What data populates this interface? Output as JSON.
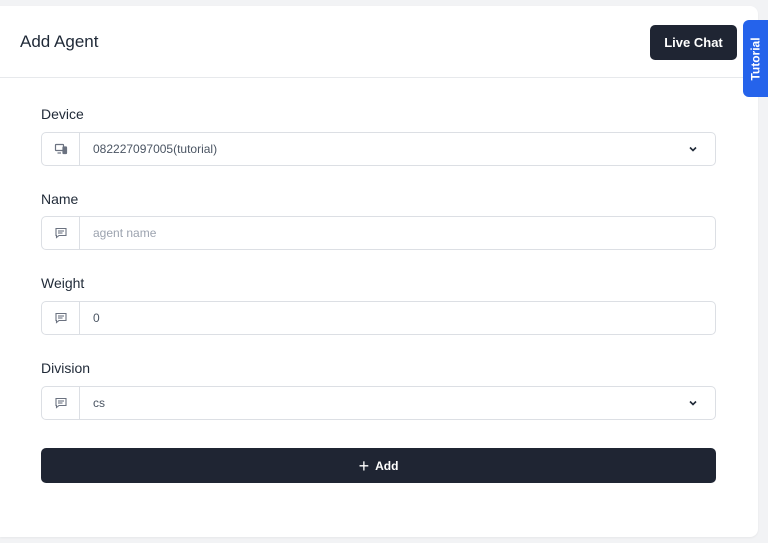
{
  "header": {
    "title": "Add Agent",
    "live_chat_label": "Live Chat"
  },
  "tutorial_tab": {
    "label": "Tutorial"
  },
  "form": {
    "device": {
      "label": "Device",
      "value": "082227097005(tutorial)",
      "icon": "device-icon"
    },
    "name": {
      "label": "Name",
      "value": "",
      "placeholder": "agent name",
      "icon": "message-icon"
    },
    "weight": {
      "label": "Weight",
      "value": "0",
      "icon": "message-icon"
    },
    "division": {
      "label": "Division",
      "value": "cs",
      "icon": "message-icon"
    },
    "submit": {
      "icon": "plus-icon",
      "label": "Add"
    }
  },
  "colors": {
    "dark_button": "#1f2533",
    "tutorial_blue": "#2563eb",
    "border": "#dcdfe4"
  }
}
